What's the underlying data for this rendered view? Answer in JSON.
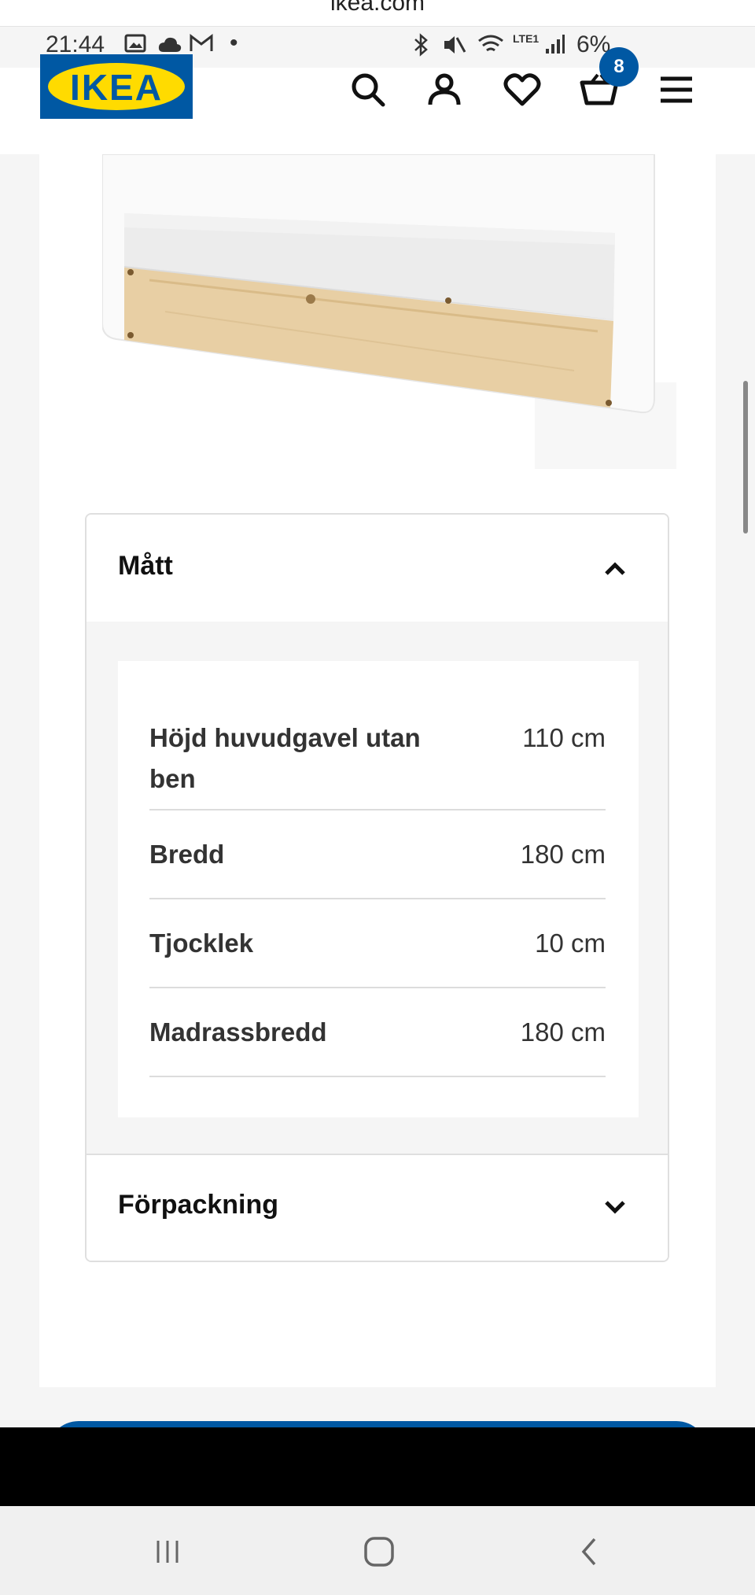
{
  "browser": {
    "url": "ikea.com"
  },
  "status_bar": {
    "time": "21:44",
    "battery": "6%",
    "network": "LTE1"
  },
  "header": {
    "logo": "IKEA",
    "cart_count": "8",
    "icons": [
      "search-icon",
      "account-icon",
      "heart-icon",
      "cart-icon",
      "menu-icon"
    ]
  },
  "sections": {
    "dimensions": {
      "title": "Mått",
      "expanded": true,
      "rows": [
        {
          "label": "Höjd huvudgavel utan ben",
          "value": "110 cm"
        },
        {
          "label": "Bredd",
          "value": "180 cm"
        },
        {
          "label": "Tjocklek",
          "value": "10 cm"
        },
        {
          "label": "Madrassbredd",
          "value": "180 cm"
        }
      ]
    },
    "packaging": {
      "title": "Förpackning",
      "expanded": false
    }
  },
  "colors": {
    "brand_blue": "#0058a3",
    "brand_yellow": "#ffdb00"
  },
  "nav": [
    "recent-apps-icon",
    "home-icon",
    "back-icon"
  ]
}
